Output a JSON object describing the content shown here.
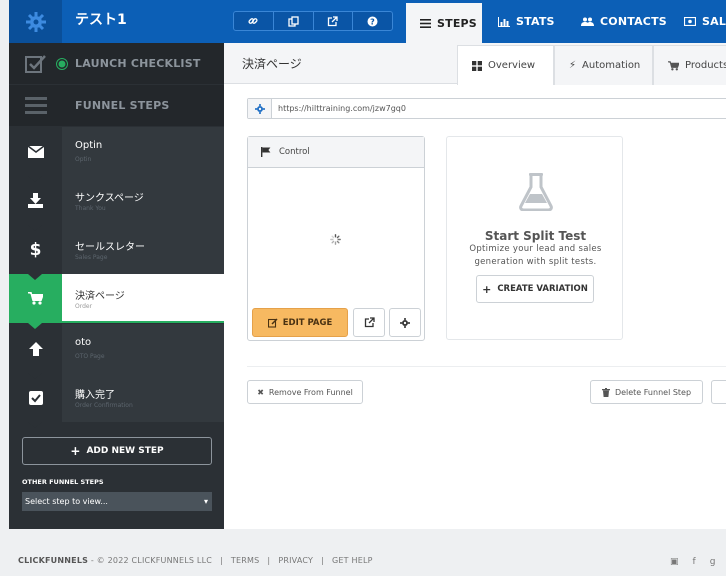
{
  "topbar": {
    "funnel_title": "テスト1",
    "tools": [
      "link-icon",
      "copy-icon",
      "external-link-icon",
      "help-icon"
    ],
    "tabs": [
      {
        "label": "STEPS",
        "icon": "list-icon",
        "active": true
      },
      {
        "label": "STATS",
        "icon": "bar-chart-icon",
        "active": false
      },
      {
        "label": "CONTACTS",
        "icon": "users-icon",
        "active": false
      },
      {
        "label": "SALE",
        "icon": "money-icon",
        "active": false
      }
    ]
  },
  "sidebar": {
    "launch_checklist": "LAUNCH CHECKLIST",
    "funnel_steps": "FUNNEL STEPS",
    "steps": [
      {
        "name": "Optin",
        "sub": "Optin",
        "icon": "envelope-icon"
      },
      {
        "name": "サンクスページ",
        "sub": "Thank You",
        "icon": "download-icon"
      },
      {
        "name": "セールスレター",
        "sub": "Sales Page",
        "icon": "dollar-icon"
      },
      {
        "name": "決済ページ",
        "sub": "Order",
        "icon": "cart-icon"
      },
      {
        "name": "oto",
        "sub": "OTO Page",
        "icon": "arrow-up-icon"
      },
      {
        "name": "購入完了",
        "sub": "Order Confirmation",
        "icon": "check-square-icon"
      }
    ],
    "add_step": "ADD NEW STEP",
    "other_steps_label": "OTHER FUNNEL STEPS",
    "step_select": "Select step to view..."
  },
  "main": {
    "page_title": "決済ページ",
    "subtabs": [
      {
        "label": "Overview",
        "icon": "grid-icon"
      },
      {
        "label": "Automation",
        "icon": "bolt-icon"
      },
      {
        "label": "Products",
        "icon": "cart-icon"
      }
    ],
    "url": "https://hilttraining.com/jzw7gq0",
    "variant": {
      "label": "Control",
      "edit_page": "EDIT PAGE"
    },
    "split_test": {
      "title": "Start Split Test",
      "desc": "Optimize your lead and sales generation with split tests.",
      "create": "CREATE VARIATION"
    },
    "remove_from_funnel": "Remove From Funnel",
    "delete_step": "Delete Funnel Step"
  },
  "footer": {
    "brand": "CLICKFUNNELS",
    "copyright": "- © 2022 CLICKFUNNELS LLC",
    "links": [
      "TERMS",
      "PRIVACY",
      "GET HELP"
    ]
  },
  "colors": {
    "brand_blue": "#0c5fb6",
    "sidebar": "#2b3035",
    "active_green": "#27ae60",
    "edit_orange": "#f7b961"
  }
}
